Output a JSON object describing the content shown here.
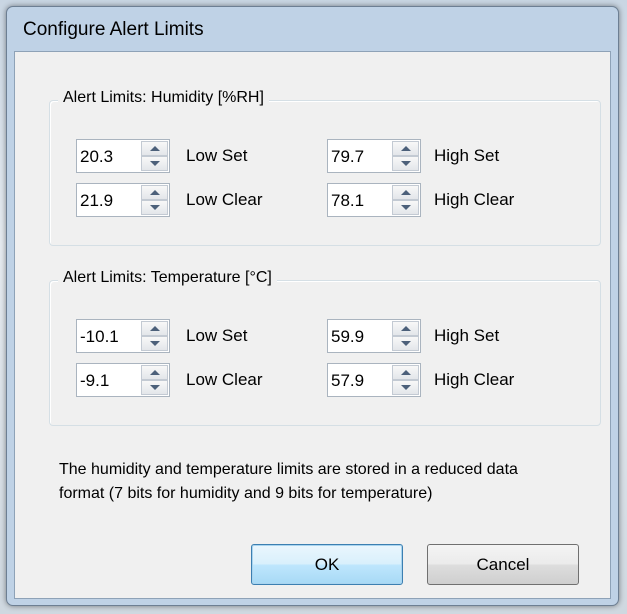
{
  "dialog": {
    "title": "Configure Alert Limits"
  },
  "humidity": {
    "legend": "Alert Limits: Humidity [%RH]",
    "low_set": {
      "value": "20.3",
      "label": "Low Set"
    },
    "high_set": {
      "value": "79.7",
      "label": "High Set"
    },
    "low_clear": {
      "value": "21.9",
      "label": "Low Clear"
    },
    "high_clear": {
      "value": "78.1",
      "label": "High Clear"
    }
  },
  "temperature": {
    "legend": "Alert Limits: Temperature [°C]",
    "low_set": {
      "value": "-10.1",
      "label": "Low Set"
    },
    "high_set": {
      "value": "59.9",
      "label": "High Set"
    },
    "low_clear": {
      "value": "-9.1",
      "label": "Low Clear"
    },
    "high_clear": {
      "value": "57.9",
      "label": "High Clear"
    }
  },
  "note": {
    "line1": "The humidity and temperature limits are stored in a reduced data",
    "line2": "format (7 bits for humidity and 9 bits for temperature)"
  },
  "buttons": {
    "ok": "OK",
    "cancel": "Cancel"
  },
  "icons": {
    "spin_up": "triangle-up",
    "spin_down": "triangle-down"
  },
  "colors": {
    "frame": "#bfd2e6",
    "client": "#f0f0f0",
    "default_button": "#bee6fd"
  }
}
